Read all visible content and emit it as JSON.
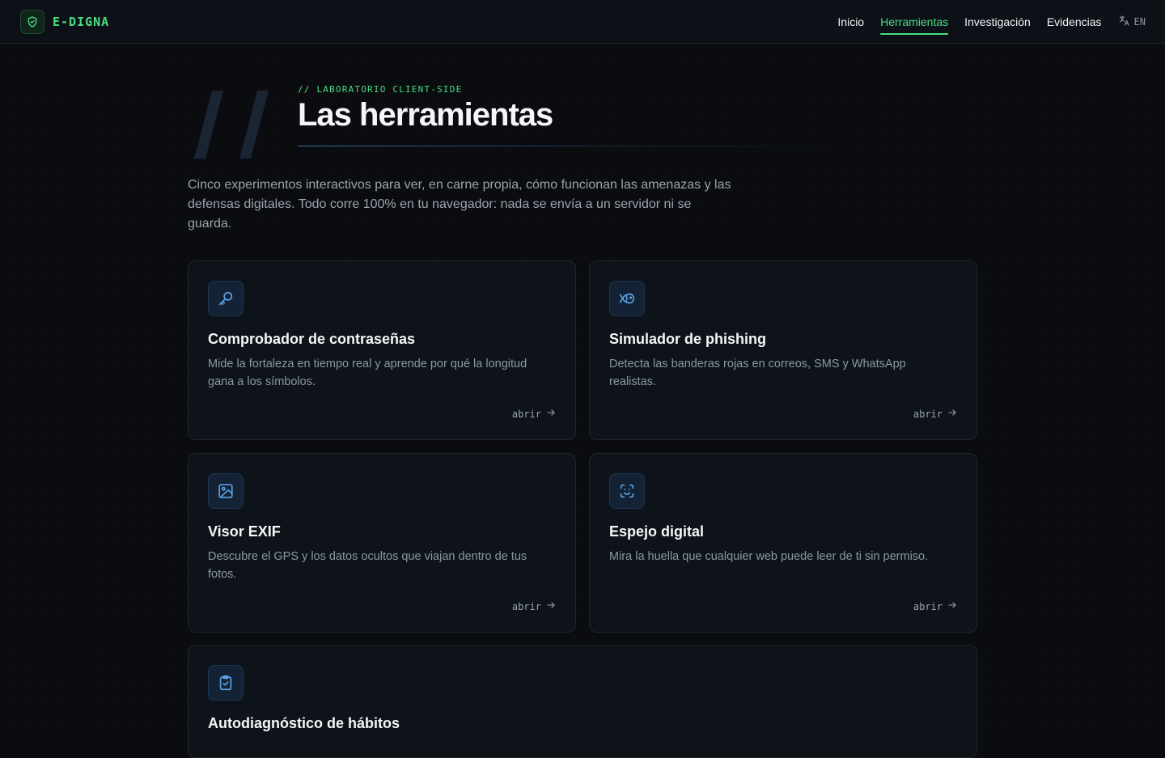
{
  "header": {
    "brand": "E-DIGNA",
    "nav": [
      {
        "label": "Inicio",
        "active": false
      },
      {
        "label": "Herramientas",
        "active": true
      },
      {
        "label": "Investigación",
        "active": false
      },
      {
        "label": "Evidencias",
        "active": false
      }
    ],
    "lang_label": "EN"
  },
  "hero": {
    "kicker": "// LABORATORIO CLIENT-SIDE",
    "title": "Las herramientas",
    "intro": "Cinco experimentos interactivos para ver, en carne propia, cómo funcionan las amenazas y las defensas digitales. Todo corre 100% en tu navegador: nada se envía a un servidor ni se guarda."
  },
  "tools": [
    {
      "icon": "key-icon",
      "title": "Comprobador de contraseñas",
      "description": "Mide la fortaleza en tiempo real y aprende por qué la longitud gana a los símbolos.",
      "link": "abrir"
    },
    {
      "icon": "fish-icon",
      "title": "Simulador de phishing",
      "description": "Detecta las banderas rojas en correos, SMS y WhatsApp realistas.",
      "link": "abrir"
    },
    {
      "icon": "image-icon",
      "title": "Visor EXIF",
      "description": "Descubre el GPS y los datos ocultos que viajan dentro de tus fotos.",
      "link": "abrir"
    },
    {
      "icon": "face-scan-icon",
      "title": "Espejo digital",
      "description": "Mira la huella que cualquier web puede leer de ti sin permiso.",
      "link": "abrir"
    },
    {
      "icon": "clipboard-check-icon",
      "title": "Autodiagnóstico de hábitos",
      "description": "",
      "link": ""
    }
  ],
  "colors": {
    "accent_green": "#4ade80",
    "accent_blue": "#5ba3e6",
    "background": "#0a0c0f",
    "card": "#0e131a"
  }
}
